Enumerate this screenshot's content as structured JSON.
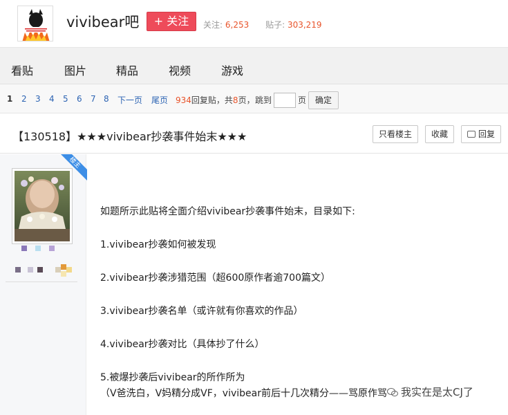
{
  "header": {
    "bar_name": "vivibear吧",
    "follow_label": "+ 关注",
    "follow_count_label": "关注:",
    "follow_count": "6,253",
    "post_count_label": "贴子:",
    "post_count": "303,219"
  },
  "nav": {
    "items": [
      {
        "label": "看贴"
      },
      {
        "label": "图片"
      },
      {
        "label": "精品"
      },
      {
        "label": "视频"
      },
      {
        "label": "游戏"
      }
    ]
  },
  "pager": {
    "pages": [
      "1",
      "2",
      "3",
      "4",
      "5",
      "6",
      "7",
      "8"
    ],
    "current_page": "1",
    "next_label": "下一页",
    "last_label": "尾页",
    "reply_count": "934",
    "reply_label": "回复贴，共",
    "total_pages": "8",
    "page_suffix": "页，",
    "jump_label": "跳到",
    "jump_value": "",
    "page_unit": "页",
    "ok_label": "确定"
  },
  "thread": {
    "title": "【130518】★★★vivibear抄袭事件始末★★★",
    "only_op_label": "只看楼主",
    "collect_label": "收藏",
    "reply_label": "回复"
  },
  "post": {
    "op_badge": "楼主",
    "lines": [
      "如题所示此贴将全面介绍vivibear抄袭事件始末，目录如下:",
      "1.vivibear抄袭如何被发现",
      "2.vivibear抄袭涉猎范围（超600原作者逾700篇文）",
      "3.vivibear抄袭名单（或许就有你喜欢的作品）",
      "4.vivibear抄袭对比（具体抄了什么）",
      "5.被爆抄袭后vivibear的所作所为",
      "（V爸洗白，V妈精分成VF，vivibear前后十几次精分——骂原作骂"
    ]
  },
  "watermark": {
    "text": "我实在是太CJ了"
  },
  "colors": {
    "follow_button": "#ee4b5a",
    "link_blue": "#2d64b3",
    "count_orange": "#e8542b",
    "ribbon_blue": "#3d8ee6"
  }
}
